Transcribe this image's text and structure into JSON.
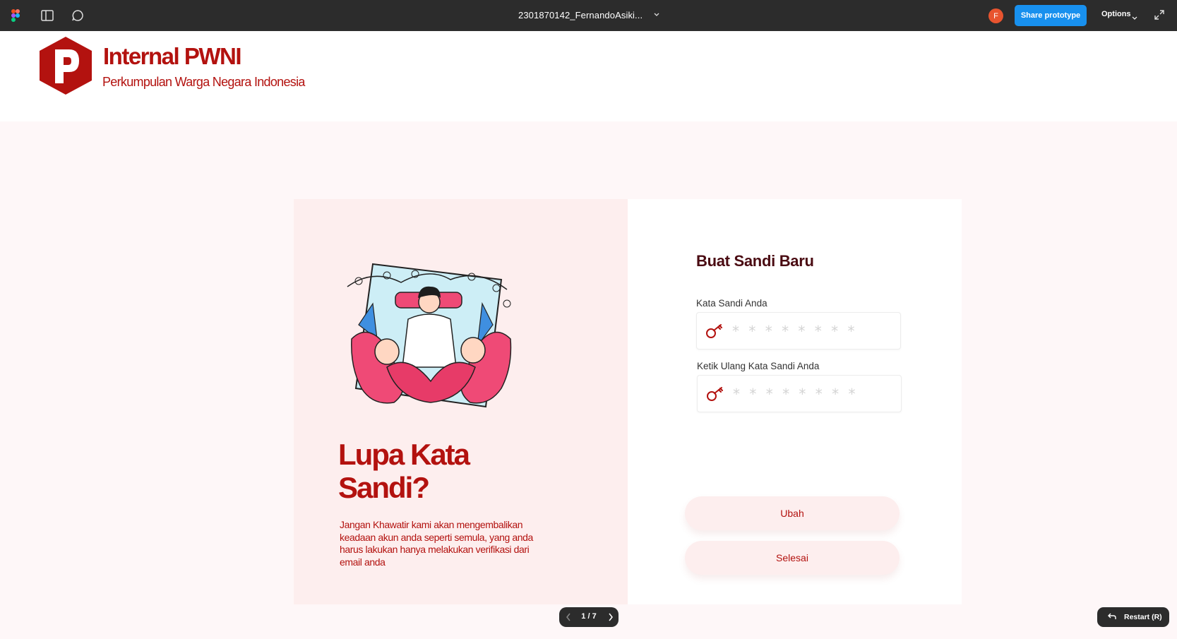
{
  "topbar": {
    "file_name": "2301870142_FernandoAsiki...",
    "avatar_initial": "F",
    "share_label": "Share prototype",
    "options_label": "Options",
    "icons": [
      "figma-logo-icon",
      "sidebar-toggle-icon",
      "comment-icon",
      "chevron-down-icon",
      "expand-icon"
    ]
  },
  "brand": {
    "title": "Internal PWNI",
    "subtitle": "Perkumpulan Warga Negara Indonesia",
    "color": "#b3120f"
  },
  "hero": {
    "title": "Lupa Kata Sandi?",
    "description": "Jangan Khawatir kami akan mengembalikan keadaan akun anda seperti semula, yang anda harus lakukan hanya melakukan verifikasi dari email anda"
  },
  "form": {
    "title": "Buat Sandi Baru",
    "fields": [
      {
        "label": "Kata Sandi Anda",
        "placeholder": "* * * * * * * *"
      },
      {
        "label": "Ketik Ulang Kata Sandi Anda",
        "placeholder": "* * * * * * * *"
      }
    ],
    "buttons": {
      "change": "Ubah",
      "done": "Selesai"
    }
  },
  "prototype": {
    "page_indicator": "1 / 7",
    "restart_label": "Restart (R)"
  },
  "colors": {
    "topbar": "#2c2c2c",
    "share": "#1890ee",
    "accent": "#b3120f",
    "panel": "#fdeeee",
    "background": "#fef7f8"
  }
}
